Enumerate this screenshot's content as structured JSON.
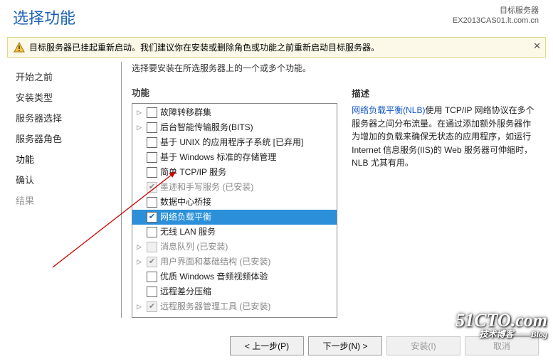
{
  "header": {
    "page_title": "选择功能",
    "target_label": "目标服务器",
    "target_server": "EX2013CAS01.lt.com.cn"
  },
  "warning": {
    "text": "目标服务器已挂起重新启动。我们建议你在安装或删除角色或功能之前重新启动目标服务器。"
  },
  "intro": "选择要安装在所选服务器上的一个或多个功能。",
  "sidebar": {
    "items": [
      {
        "label": "开始之前"
      },
      {
        "label": "安装类型"
      },
      {
        "label": "服务器选择"
      },
      {
        "label": "服务器角色"
      },
      {
        "label": "功能",
        "current": true
      },
      {
        "label": "确认"
      },
      {
        "label": "结果",
        "dim": true
      }
    ]
  },
  "features": {
    "heading": "功能",
    "items": [
      {
        "exp": true,
        "checked": false,
        "disabled": false,
        "label": "故障转移群集"
      },
      {
        "exp": true,
        "checked": false,
        "disabled": false,
        "label": "后台智能传输服务(BITS)"
      },
      {
        "exp": false,
        "checked": false,
        "disabled": false,
        "label": "基于 UNIX 的应用程序子系统 [已弃用]"
      },
      {
        "exp": false,
        "checked": false,
        "disabled": false,
        "label": "基于 Windows 标准的存储管理"
      },
      {
        "exp": false,
        "checked": false,
        "disabled": false,
        "label": "简单 TCP/IP 服务"
      },
      {
        "exp": false,
        "checked": true,
        "disabled": true,
        "label": "墨迹和手写服务 (已安装)"
      },
      {
        "exp": false,
        "checked": false,
        "disabled": false,
        "label": "数据中心桥接"
      },
      {
        "exp": false,
        "checked": true,
        "disabled": false,
        "label": "网络负载平衡",
        "sel": true
      },
      {
        "exp": false,
        "checked": false,
        "disabled": false,
        "label": "无线 LAN 服务"
      },
      {
        "exp": true,
        "checked": false,
        "disabled": true,
        "label": "消息队列 (已安装)"
      },
      {
        "exp": true,
        "checked": true,
        "disabled": true,
        "label": "用户界面和基础结构 (已安装)"
      },
      {
        "exp": false,
        "checked": false,
        "disabled": false,
        "label": "优质 Windows 音频视频体验"
      },
      {
        "exp": false,
        "checked": false,
        "disabled": false,
        "label": "远程差分压缩"
      },
      {
        "exp": true,
        "checked": true,
        "disabled": true,
        "label": "远程服务器管理工具 (已安装)"
      }
    ]
  },
  "description": {
    "heading": "描述",
    "link_text": "网络负载平衡(NLB)",
    "body": "使用 TCP/IP 网络协议在多个服务器之间分布流量。在通过添加额外服务器作为增加的负载来确保无状态的应用程序，如运行Internet 信息服务(IIS)的 Web 服务器可伸缩时，NLB 尤其有用。"
  },
  "buttons": {
    "prev": "< 上一步(P)",
    "next": "下一步(N) >",
    "install": "安装(I)",
    "cancel": "取消"
  },
  "watermark": {
    "main": "51CTO.com",
    "sub": "技术博客——Blog"
  }
}
